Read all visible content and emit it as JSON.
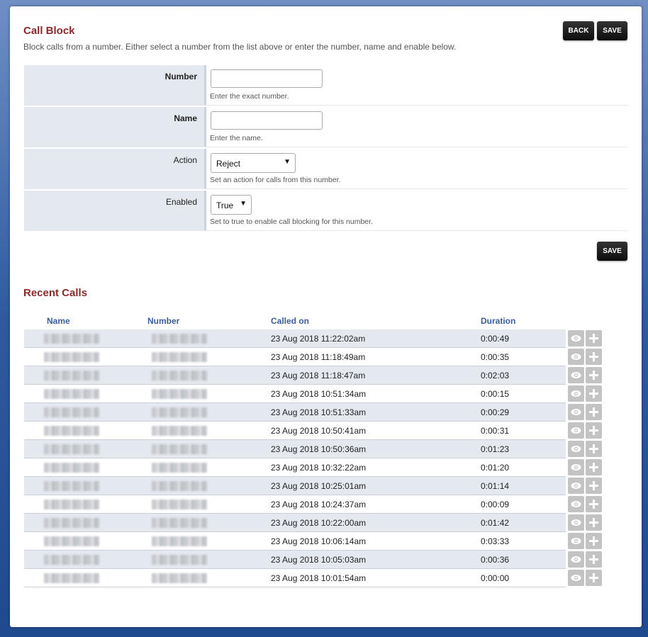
{
  "header": {
    "title": "Call Block",
    "description": "Block calls from a number. Either select a number from the list above or enter the number, name and enable below.",
    "back_label": "BACK",
    "save_label": "SAVE"
  },
  "form": {
    "number": {
      "label": "Number",
      "value": "",
      "help": "Enter the exact number."
    },
    "name": {
      "label": "Name",
      "value": "",
      "help": "Enter the name."
    },
    "action": {
      "label": "Action",
      "value": "Reject",
      "help": "Set an action for calls from this number."
    },
    "enabled": {
      "label": "Enabled",
      "value": "True",
      "help": "Set to true to enable call blocking for this number."
    },
    "save_label": "SAVE"
  },
  "recent": {
    "title": "Recent Calls",
    "columns": [
      "Name",
      "Number",
      "Called on",
      "Duration"
    ],
    "rows": [
      {
        "called_on": "23 Aug 2018 11:22:02am",
        "duration": "0:00:49"
      },
      {
        "called_on": "23 Aug 2018 11:18:49am",
        "duration": "0:00:35"
      },
      {
        "called_on": "23 Aug 2018 11:18:47am",
        "duration": "0:02:03"
      },
      {
        "called_on": "23 Aug 2018 10:51:34am",
        "duration": "0:00:15"
      },
      {
        "called_on": "23 Aug 2018 10:51:33am",
        "duration": "0:00:29"
      },
      {
        "called_on": "23 Aug 2018 10:50:41am",
        "duration": "0:00:31"
      },
      {
        "called_on": "23 Aug 2018 10:50:36am",
        "duration": "0:01:23"
      },
      {
        "called_on": "23 Aug 2018 10:32:22am",
        "duration": "0:01:20"
      },
      {
        "called_on": "23 Aug 2018 10:25:01am",
        "duration": "0:01:14"
      },
      {
        "called_on": "23 Aug 2018 10:24:37am",
        "duration": "0:00:09"
      },
      {
        "called_on": "23 Aug 2018 10:22:00am",
        "duration": "0:01:42"
      },
      {
        "called_on": "23 Aug 2018 10:06:14am",
        "duration": "0:03:33"
      },
      {
        "called_on": "23 Aug 2018 10:05:03am",
        "duration": "0:00:36"
      },
      {
        "called_on": "23 Aug 2018 10:01:54am",
        "duration": "0:00:00"
      }
    ],
    "row_icons": [
      "eye-icon",
      "plus-icon"
    ]
  }
}
